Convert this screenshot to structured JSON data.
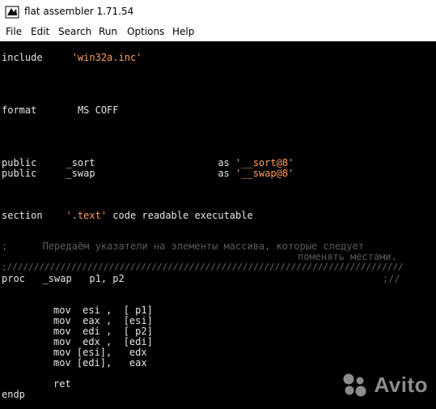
{
  "window": {
    "title": "flat assembler 1.71.54",
    "icon": "fasm-app-icon"
  },
  "menu": [
    "File",
    "Edit",
    "Search",
    "Run",
    "Options",
    "Help"
  ],
  "code": {
    "include_kw": "include",
    "include_file": "'win32a.inc'",
    "format_kw": "format",
    "format_val": "MS COFF",
    "public1_kw": "public",
    "public1_name": "_sort",
    "public1_as": "as",
    "public1_alias": "'__sort@8'",
    "public2_kw": "public",
    "public2_name": "_swap",
    "public2_as": "as",
    "public2_alias": "'__swap@8'",
    "section_kw": "section",
    "section_name": "'.text'",
    "section_flags": "code readable executable",
    "comment_semicolon": ";",
    "comment1": "Передаём указатели на элементы массива, которые следует",
    "comment2": "поменять местами.",
    "separator": ";/////////////////////////////////////////////////////////////////////////////",
    "proc_line": "proc   _swap   p1, p2",
    "proc_tail": ";//",
    "instr": [
      "mov  esi ,  [ p1]",
      "mov  eax ,  [esi]",
      "mov  edi ,  [ p2]",
      "mov  edx ,  [edi]",
      "mov [esi],   edx",
      "mov [edi],   eax"
    ],
    "ret": "ret",
    "endp": "endp"
  },
  "watermark": {
    "text": "Avito",
    "colors": [
      "#00aaff",
      "#a169f7",
      "#ff4053",
      "#97cf26"
    ]
  }
}
